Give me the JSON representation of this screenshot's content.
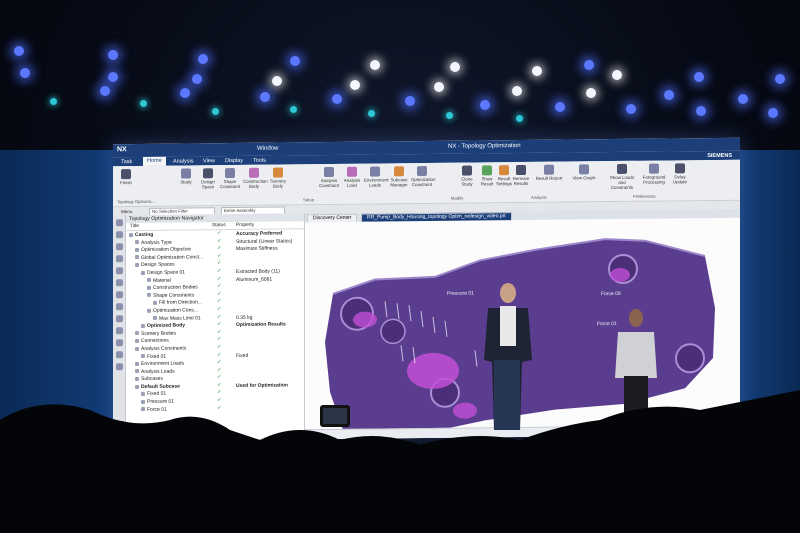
{
  "app": {
    "logo": "NX",
    "window_menu": "Window",
    "title": "NX - Topology Optimization",
    "brand": "SIEMENS"
  },
  "menu": [
    "Task",
    "Home",
    "Analysis",
    "View",
    "Display",
    "Tools"
  ],
  "ribbon": {
    "buttons": [
      {
        "label": "Finish",
        "icon": "checkered-flag-icon"
      },
      {
        "label": "Study",
        "icon": "study-icon"
      },
      {
        "label": "Design Space",
        "icon": "design-space-icon"
      },
      {
        "label": "Shape Constraint",
        "icon": "shape-constraint-icon"
      },
      {
        "label": "Construction Body",
        "icon": "construction-body-icon"
      },
      {
        "label": "Scenery Body",
        "icon": "scenery-body-icon"
      },
      {
        "label": "Analysis Constraint",
        "icon": "analysis-constraint-icon"
      },
      {
        "label": "Analysis Load",
        "icon": "analysis-load-icon"
      },
      {
        "label": "Environment Loads",
        "icon": "environment-loads-icon"
      },
      {
        "label": "Subcase Manager",
        "icon": "subcase-manager-icon"
      },
      {
        "label": "Optimization Constraint",
        "icon": "optimization-constraint-icon"
      },
      {
        "label": "Clone Study",
        "icon": "clone-study-icon"
      },
      {
        "label": "Show Result",
        "icon": "show-result-icon"
      },
      {
        "label": "Result Settings",
        "icon": "result-settings-icon"
      },
      {
        "label": "Remove Results",
        "icon": "remove-results-icon"
      },
      {
        "label": "Result Report",
        "icon": "result-report-icon"
      },
      {
        "label": "View Graph",
        "icon": "view-graph-icon"
      },
      {
        "label": "Show Loads and Constraints",
        "icon": "show-loads-icon"
      },
      {
        "label": "Foreground Processing",
        "icon": "foreground-processing-icon"
      },
      {
        "label": "Delay Update",
        "icon": "delay-update-icon"
      }
    ],
    "groups": [
      "Topology Optimiza...",
      "Setup",
      "Modify",
      "Analysis",
      "Preferences"
    ]
  },
  "toolbar": {
    "menu": "Menu",
    "selection_filter": "No Selection Filter",
    "assembly_scope": "Entire Assembly"
  },
  "navigator": {
    "title": "Topology Optimization Navigator",
    "col_title": "Title",
    "col_status": "Status",
    "col_property": "Property",
    "rows": [
      {
        "title": "Casting",
        "property": "Accuracy Preferred",
        "bold": true,
        "indent": 0
      },
      {
        "title": "Analysis Type",
        "property": "Structural (Linear Statics)",
        "bold": false,
        "indent": 1
      },
      {
        "title": "Optimization Objective",
        "property": "Maximize Stiffness",
        "bold": false,
        "indent": 1
      },
      {
        "title": "Global Optimization Const...",
        "property": "",
        "bold": false,
        "indent": 1
      },
      {
        "title": "Design Spaces",
        "property": "",
        "bold": false,
        "indent": 1
      },
      {
        "title": "Design Space 01",
        "property": "Extracted Body (11)",
        "bold": false,
        "indent": 2
      },
      {
        "title": "Material",
        "property": "Aluminum_6061",
        "bold": false,
        "indent": 3
      },
      {
        "title": "Construction Bodies",
        "property": "",
        "bold": false,
        "indent": 3
      },
      {
        "title": "Shape Constraints",
        "property": "",
        "bold": false,
        "indent": 3
      },
      {
        "title": "Fill from Direction...",
        "property": "",
        "bold": false,
        "indent": 4
      },
      {
        "title": "Optimization Cons...",
        "property": "",
        "bold": false,
        "indent": 3
      },
      {
        "title": "Max Mass Limit 01",
        "property": "0.35 kg",
        "bold": false,
        "indent": 4
      },
      {
        "title": "Optimized Body",
        "property": "Optimization Results",
        "bold": true,
        "indent": 2
      },
      {
        "title": "Scenery Bodies",
        "property": "",
        "bold": false,
        "indent": 1
      },
      {
        "title": "Connections",
        "property": "",
        "bold": false,
        "indent": 1
      },
      {
        "title": "Analysis Constraints",
        "property": "",
        "bold": false,
        "indent": 1
      },
      {
        "title": "Fixed 01",
        "property": "Fixed",
        "bold": false,
        "indent": 2
      },
      {
        "title": "Environment Loads",
        "property": "",
        "bold": false,
        "indent": 1
      },
      {
        "title": "Analysis Loads",
        "property": "",
        "bold": false,
        "indent": 1
      },
      {
        "title": "Subcases",
        "property": "",
        "bold": false,
        "indent": 1
      },
      {
        "title": "Default Subcase",
        "property": "Used for Optimization",
        "bold": true,
        "indent": 1
      },
      {
        "title": "Fixed 01",
        "property": "",
        "bold": false,
        "indent": 2
      },
      {
        "title": "Pressure 01",
        "property": "",
        "bold": false,
        "indent": 2
      },
      {
        "title": "Force 01",
        "property": "",
        "bold": false,
        "indent": 2
      }
    ]
  },
  "viewport": {
    "tabs": [
      "Discovery Center",
      "RR_Pump_Body_Housing_topology Optim_redesign_video.prt"
    ],
    "labels": [
      "Pressure 01",
      "Force 01",
      "Force 08"
    ]
  },
  "colors": {
    "title_bar": "#1c3f7a",
    "part_body": "#5b3d8f",
    "optimized_result": "#c24fd6",
    "stage_light": "#5b78ff"
  }
}
